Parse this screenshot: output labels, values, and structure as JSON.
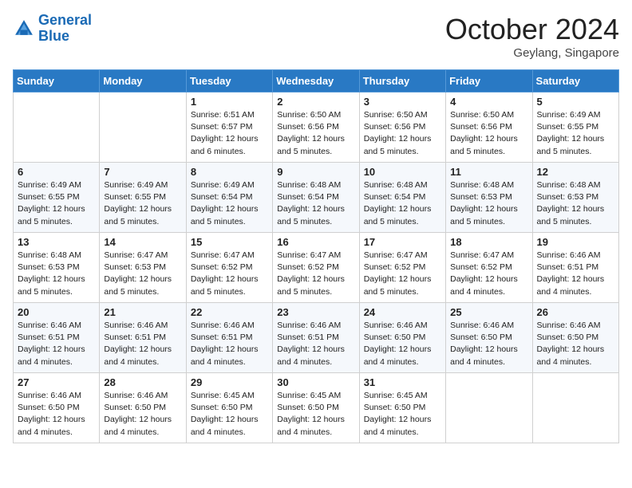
{
  "header": {
    "logo_line1": "General",
    "logo_line2": "Blue",
    "month": "October 2024",
    "location": "Geylang, Singapore"
  },
  "days_of_week": [
    "Sunday",
    "Monday",
    "Tuesday",
    "Wednesday",
    "Thursday",
    "Friday",
    "Saturday"
  ],
  "weeks": [
    [
      {
        "day": "",
        "info": ""
      },
      {
        "day": "",
        "info": ""
      },
      {
        "day": "1",
        "info": "Sunrise: 6:51 AM\nSunset: 6:57 PM\nDaylight: 12 hours and 6 minutes."
      },
      {
        "day": "2",
        "info": "Sunrise: 6:50 AM\nSunset: 6:56 PM\nDaylight: 12 hours and 5 minutes."
      },
      {
        "day": "3",
        "info": "Sunrise: 6:50 AM\nSunset: 6:56 PM\nDaylight: 12 hours and 5 minutes."
      },
      {
        "day": "4",
        "info": "Sunrise: 6:50 AM\nSunset: 6:56 PM\nDaylight: 12 hours and 5 minutes."
      },
      {
        "day": "5",
        "info": "Sunrise: 6:49 AM\nSunset: 6:55 PM\nDaylight: 12 hours and 5 minutes."
      }
    ],
    [
      {
        "day": "6",
        "info": "Sunrise: 6:49 AM\nSunset: 6:55 PM\nDaylight: 12 hours and 5 minutes."
      },
      {
        "day": "7",
        "info": "Sunrise: 6:49 AM\nSunset: 6:55 PM\nDaylight: 12 hours and 5 minutes."
      },
      {
        "day": "8",
        "info": "Sunrise: 6:49 AM\nSunset: 6:54 PM\nDaylight: 12 hours and 5 minutes."
      },
      {
        "day": "9",
        "info": "Sunrise: 6:48 AM\nSunset: 6:54 PM\nDaylight: 12 hours and 5 minutes."
      },
      {
        "day": "10",
        "info": "Sunrise: 6:48 AM\nSunset: 6:54 PM\nDaylight: 12 hours and 5 minutes."
      },
      {
        "day": "11",
        "info": "Sunrise: 6:48 AM\nSunset: 6:53 PM\nDaylight: 12 hours and 5 minutes."
      },
      {
        "day": "12",
        "info": "Sunrise: 6:48 AM\nSunset: 6:53 PM\nDaylight: 12 hours and 5 minutes."
      }
    ],
    [
      {
        "day": "13",
        "info": "Sunrise: 6:48 AM\nSunset: 6:53 PM\nDaylight: 12 hours and 5 minutes."
      },
      {
        "day": "14",
        "info": "Sunrise: 6:47 AM\nSunset: 6:53 PM\nDaylight: 12 hours and 5 minutes."
      },
      {
        "day": "15",
        "info": "Sunrise: 6:47 AM\nSunset: 6:52 PM\nDaylight: 12 hours and 5 minutes."
      },
      {
        "day": "16",
        "info": "Sunrise: 6:47 AM\nSunset: 6:52 PM\nDaylight: 12 hours and 5 minutes."
      },
      {
        "day": "17",
        "info": "Sunrise: 6:47 AM\nSunset: 6:52 PM\nDaylight: 12 hours and 5 minutes."
      },
      {
        "day": "18",
        "info": "Sunrise: 6:47 AM\nSunset: 6:52 PM\nDaylight: 12 hours and 4 minutes."
      },
      {
        "day": "19",
        "info": "Sunrise: 6:46 AM\nSunset: 6:51 PM\nDaylight: 12 hours and 4 minutes."
      }
    ],
    [
      {
        "day": "20",
        "info": "Sunrise: 6:46 AM\nSunset: 6:51 PM\nDaylight: 12 hours and 4 minutes."
      },
      {
        "day": "21",
        "info": "Sunrise: 6:46 AM\nSunset: 6:51 PM\nDaylight: 12 hours and 4 minutes."
      },
      {
        "day": "22",
        "info": "Sunrise: 6:46 AM\nSunset: 6:51 PM\nDaylight: 12 hours and 4 minutes."
      },
      {
        "day": "23",
        "info": "Sunrise: 6:46 AM\nSunset: 6:51 PM\nDaylight: 12 hours and 4 minutes."
      },
      {
        "day": "24",
        "info": "Sunrise: 6:46 AM\nSunset: 6:50 PM\nDaylight: 12 hours and 4 minutes."
      },
      {
        "day": "25",
        "info": "Sunrise: 6:46 AM\nSunset: 6:50 PM\nDaylight: 12 hours and 4 minutes."
      },
      {
        "day": "26",
        "info": "Sunrise: 6:46 AM\nSunset: 6:50 PM\nDaylight: 12 hours and 4 minutes."
      }
    ],
    [
      {
        "day": "27",
        "info": "Sunrise: 6:46 AM\nSunset: 6:50 PM\nDaylight: 12 hours and 4 minutes."
      },
      {
        "day": "28",
        "info": "Sunrise: 6:46 AM\nSunset: 6:50 PM\nDaylight: 12 hours and 4 minutes."
      },
      {
        "day": "29",
        "info": "Sunrise: 6:45 AM\nSunset: 6:50 PM\nDaylight: 12 hours and 4 minutes."
      },
      {
        "day": "30",
        "info": "Sunrise: 6:45 AM\nSunset: 6:50 PM\nDaylight: 12 hours and 4 minutes."
      },
      {
        "day": "31",
        "info": "Sunrise: 6:45 AM\nSunset: 6:50 PM\nDaylight: 12 hours and 4 minutes."
      },
      {
        "day": "",
        "info": ""
      },
      {
        "day": "",
        "info": ""
      }
    ]
  ]
}
